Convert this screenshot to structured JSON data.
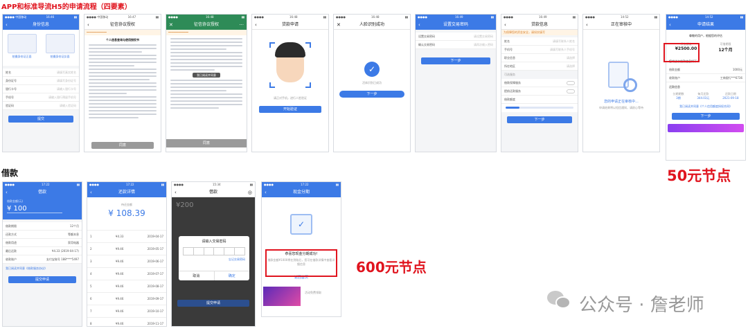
{
  "page": {
    "title": "APP和标准导流H5的申请流程（四要素）",
    "section_borrow": "借款",
    "annotation_50": "50元节点",
    "annotation_600": "600元节点",
    "watermark": "公众号 · 詹老师"
  },
  "screens": {
    "s1": {
      "title": "身份信息",
      "btn_front": "拍摄身份证正面",
      "btn_back": "拍摄身份证反面",
      "rows": [
        [
          "姓名",
          "请填写真实姓名"
        ],
        [
          "身份证号",
          "请填写身份证号"
        ],
        [
          "银行卡号",
          "请输入银行卡号"
        ],
        [
          "手机号",
          "请输入银行预留手机号"
        ],
        [
          "验证码",
          "请输入验证码"
        ]
      ],
      "submit": "提交"
    },
    "s2": {
      "title": "征信协议授权",
      "doc_title": "个人信息查询与使用授权书",
      "btn": "同意"
    },
    "s3": {
      "title": "征信协议授权",
      "badge": "我已阅读并同意",
      "btn": "同意"
    },
    "s4": {
      "title": "贷款申请",
      "hint": "请正对手机，进行人脸验证",
      "btn": "开始验证"
    },
    "s5": {
      "title": "人脸识别成功",
      "msg": "活体识别已成功",
      "btn": "下一步"
    },
    "s6": {
      "title": "设置交易密码",
      "row1": "设置交易密码",
      "row1_ph": "请设置交易密码",
      "row2": "确认交易密码",
      "row2_ph": "请再次输入密码",
      "btn": "下一步"
    },
    "s7": {
      "title": "贷款信息",
      "notice": "为保障您的资金安全，请如实填写",
      "rows": [
        [
          "姓名",
          "请填写联系人姓名"
        ],
        [
          "手机号",
          "请填写联系人手机号"
        ],
        [
          "职业信息",
          "请选择"
        ],
        [
          "所在地区",
          "请选择"
        ]
      ],
      "section": "可选服务",
      "opt1": "借款保障服务",
      "opt2": "提前还款服务",
      "slider_label": "借款额度",
      "btn": "下一步"
    },
    "s8": {
      "title": "正在审核中",
      "msg": "您的申请正在审核中...",
      "sub": "申请结果将以短信通知，请耐心等待"
    },
    "s9": {
      "title": "申请结果",
      "greeting": "尊敬的用户，根据您的评估",
      "amount_label": "授信额度",
      "amount": "¥2500.00",
      "term_label": "可借期限",
      "term": "12个月",
      "sub_title": "您的该次借款信息如下：",
      "loan_amount_label": "借款金额",
      "loan_amount": "1000元",
      "account_label": "收款账户",
      "account": "工商银行***6736",
      "repay_title": "还款信息",
      "repay_cols": [
        "分期期数",
        "每月还款",
        "还款日期"
      ],
      "repay_vals": [
        "3期",
        "344.03元",
        "2021-09-18"
      ],
      "agree": "我已阅读并同意《个人信用额度授权合同》",
      "btn": "下一步"
    },
    "b1": {
      "title": "借款",
      "amount_label": "借款金额(元)",
      "amount": "¥ 100",
      "rows": [
        [
          "借款期限",
          "12个月"
        ],
        [
          "还款方式",
          "等额本息"
        ],
        [
          "借款用途",
          "家用电器"
        ],
        [
          "最后还款",
          "¥4.33 (2019-04-17)"
        ],
        [
          "收款账户",
          "支付宝账号 188****5497"
        ]
      ],
      "agree": "我已阅读并同意《借款服务协议》",
      "btn": "提交申请"
    },
    "b2": {
      "title": "还款详情",
      "total_label": "待还金额",
      "total": "¥ 108.39",
      "list": [
        [
          "1",
          "¥4.33",
          "2019-04-17"
        ],
        [
          "2",
          "¥9.46",
          "2019-05-17"
        ],
        [
          "3",
          "¥9.46",
          "2019-06-17"
        ],
        [
          "4",
          "¥9.46",
          "2019-07-17"
        ],
        [
          "5",
          "¥9.46",
          "2019-08-17"
        ],
        [
          "6",
          "¥9.46",
          "2019-09-17"
        ],
        [
          "7",
          "¥9.46",
          "2019-10-17"
        ],
        [
          "8",
          "¥9.46",
          "2019-11-17"
        ]
      ]
    },
    "b3": {
      "title": "借款",
      "amount": "¥200",
      "dialog_title": "请输入交易密码",
      "forget": "忘记交易密码",
      "cancel": "取消",
      "ok": "确定",
      "btn": "提交申请"
    },
    "b4": {
      "title": "现金分期",
      "success": "恭喜您现金分期成功!",
      "success_sub": "借款金额¥1000将在到账后，您可在借款详情中查看详细信息",
      "link": "返回首页",
      "ad": "活动免费领取"
    }
  }
}
